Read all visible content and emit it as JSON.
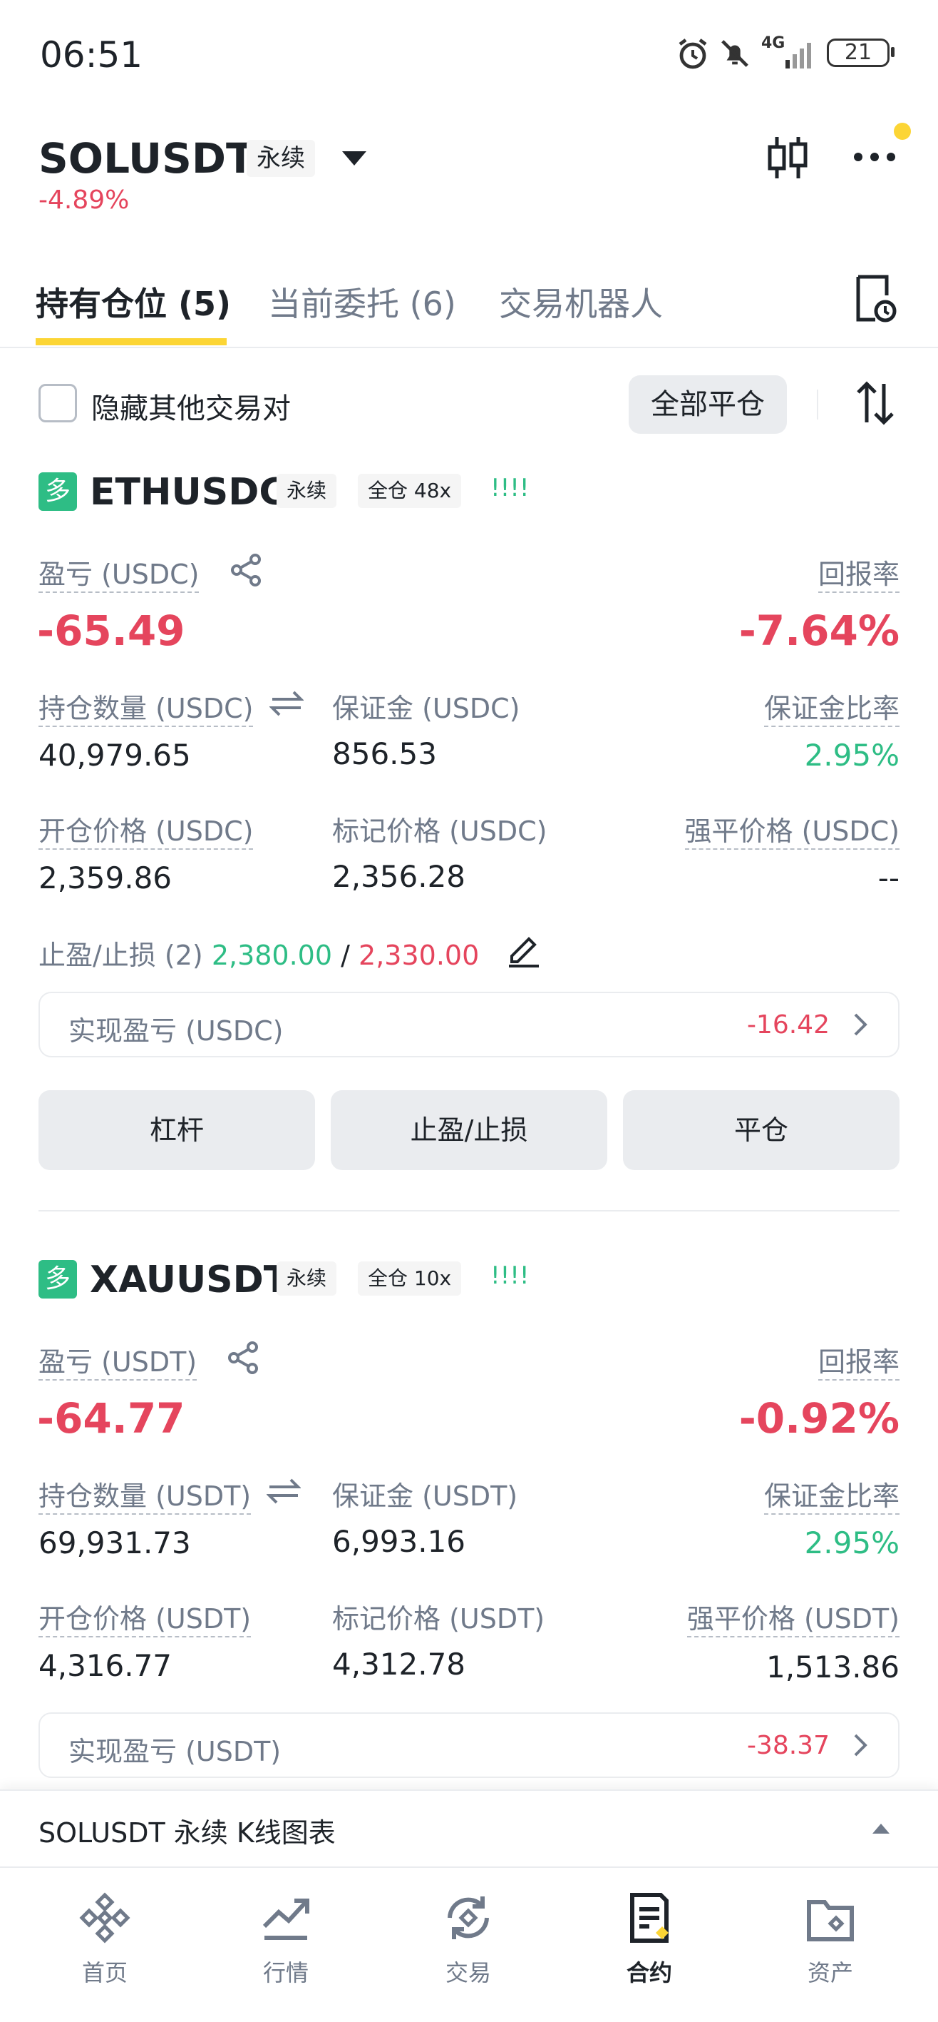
{
  "status_bar": {
    "time": "06:51",
    "network": "4G",
    "battery": "21"
  },
  "header": {
    "symbol": "SOLUSDT",
    "type_tag": "永续",
    "change": "-4.89%"
  },
  "tabs": [
    {
      "label": "持有仓位 (5)",
      "active": true
    },
    {
      "label": "当前委托 (6)",
      "active": false
    },
    {
      "label": "交易机器人",
      "active": false
    }
  ],
  "filter": {
    "hide_others_label": "隐藏其他交易对",
    "hide_others_checked": false,
    "close_all_label": "全部平仓"
  },
  "positions": [
    {
      "side": "多",
      "symbol": "ETHUSDC",
      "type_tag": "永续",
      "margin_tag": "全仓 48x",
      "signal": "!!!!",
      "pnl_label": "盈亏 (USDC)",
      "pnl": "-65.49",
      "roe_label": "回报率",
      "roe": "-7.64%",
      "size_label": "持仓数量 (USDC)",
      "size": "40,979.65",
      "margin_label": "保证金 (USDC)",
      "margin": "856.53",
      "margin_ratio_label": "保证金比率",
      "margin_ratio": "2.95%",
      "entry_label": "开仓价格 (USDC)",
      "entry": "2,359.86",
      "mark_label": "标记价格 (USDC)",
      "mark": "2,356.28",
      "liq_label": "强平价格 (USDC)",
      "liq": "--",
      "tpsl_label": "止盈/止损 (2)",
      "tp": "2,380.00",
      "tpsl_sep": "/",
      "sl": "2,330.00",
      "realized_label": "实现盈亏 (USDC)",
      "realized": "-16.42",
      "buttons": [
        "杠杆",
        "止盈/止损",
        "平仓"
      ]
    },
    {
      "side": "多",
      "symbol": "XAUUSDT",
      "type_tag": "永续",
      "margin_tag": "全仓 10x",
      "signal": "!!!!",
      "pnl_label": "盈亏 (USDT)",
      "pnl": "-64.77",
      "roe_label": "回报率",
      "roe": "-0.92%",
      "size_label": "持仓数量 (USDT)",
      "size": "69,931.73",
      "margin_label": "保证金 (USDT)",
      "margin": "6,993.16",
      "margin_ratio_label": "保证金比率",
      "margin_ratio": "2.95%",
      "entry_label": "开仓价格 (USDT)",
      "entry": "4,316.77",
      "mark_label": "标记价格 (USDT)",
      "mark": "4,312.78",
      "liq_label": "强平价格 (USDT)",
      "liq": "1,513.86",
      "realized_label": "实现盈亏 (USDT)",
      "realized": "-38.37"
    }
  ],
  "chart_bar": {
    "label": "SOLUSDT 永续 K线图表"
  },
  "bottom_nav": [
    {
      "label": "首页",
      "icon": "home-icon",
      "active": false
    },
    {
      "label": "行情",
      "icon": "markets-icon",
      "active": false
    },
    {
      "label": "交易",
      "icon": "trade-icon",
      "active": false
    },
    {
      "label": "合约",
      "icon": "futures-icon",
      "active": true
    },
    {
      "label": "资产",
      "icon": "wallet-icon",
      "active": false
    }
  ],
  "colors": {
    "accent": "#fcd535",
    "up": "#2ebd85",
    "down": "#e5455d",
    "text": "#1e2329",
    "muted": "#707a8a"
  }
}
